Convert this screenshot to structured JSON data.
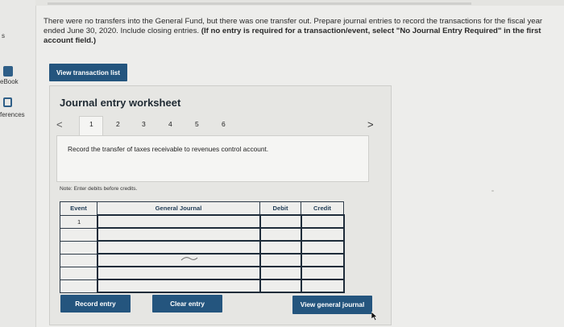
{
  "sidebar": {
    "top_label": "s",
    "ebook_label": "eBook",
    "references_label": "ferences"
  },
  "instructions": {
    "text": "There were no transfers into the General Fund, but there was one transfer out. Prepare journal entries to record the transactions for the fiscal year ended June 30, 2020. Include closing entries.",
    "bold": "(If no entry is required for a transaction/event, select \"No Journal Entry Required\" in the first account field.)"
  },
  "buttons": {
    "view_transaction_list": "View transaction list",
    "record_entry": "Record entry",
    "clear_entry": "Clear entry",
    "view_general_journal": "View general journal"
  },
  "worksheet": {
    "title": "Journal entry worksheet",
    "tabs": [
      "1",
      "2",
      "3",
      "4",
      "5",
      "6"
    ],
    "active_tab": "1",
    "prev_arrow": "<",
    "next_arrow": ">",
    "description": "Record the transfer of taxes receivable to revenues control account.",
    "note": "Note: Enter debits before credits."
  },
  "journal_table": {
    "headers": [
      "Event",
      "General Journal",
      "Debit",
      "Credit"
    ],
    "rows": [
      {
        "event": "1",
        "account": "",
        "debit": "",
        "credit": ""
      },
      {
        "event": "",
        "account": "",
        "debit": "",
        "credit": ""
      },
      {
        "event": "",
        "account": "",
        "debit": "",
        "credit": ""
      },
      {
        "event": "",
        "account": "",
        "debit": "",
        "credit": ""
      },
      {
        "event": "",
        "account": "",
        "debit": "",
        "credit": ""
      },
      {
        "event": "",
        "account": "",
        "debit": "",
        "credit": ""
      }
    ]
  },
  "colors": {
    "button_blue": "#24557e",
    "header_text": "#1f3b55"
  }
}
